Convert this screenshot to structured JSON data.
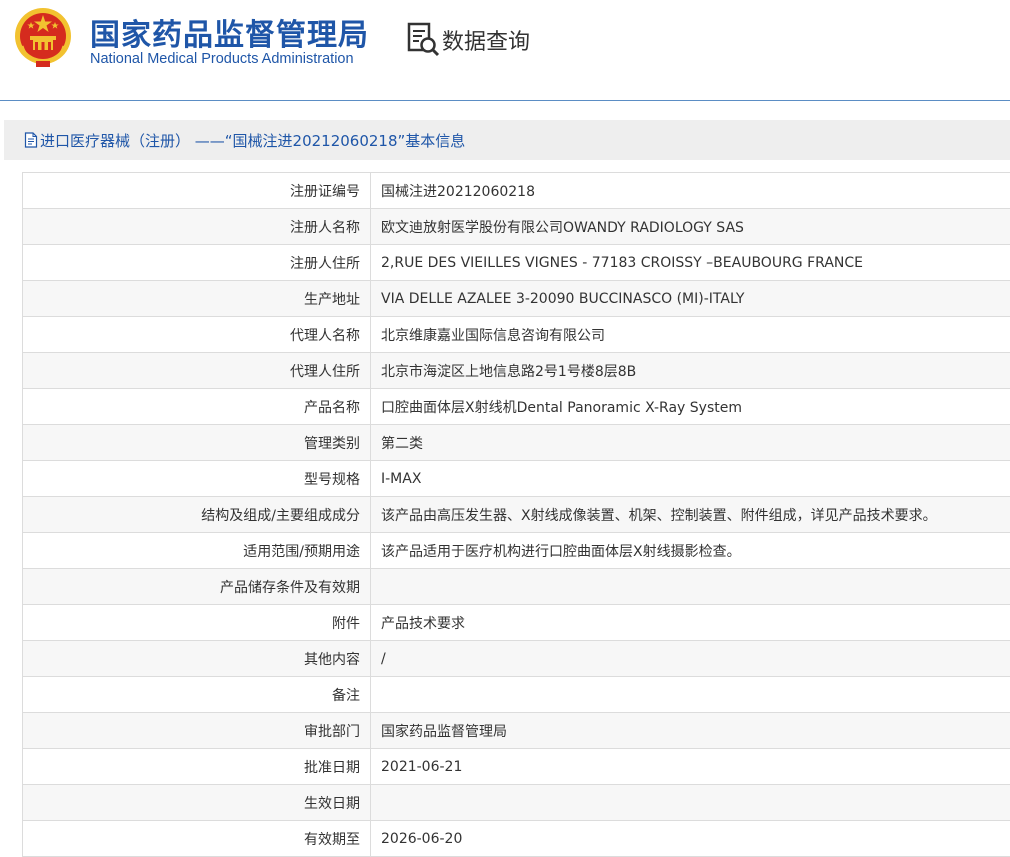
{
  "header": {
    "org_name_cn": "国家药品监督管理局",
    "org_name_en": "National Medical Products Administration",
    "query_label": "数据查询",
    "emblem_icon": "national-emblem-icon",
    "query_icon": "document-search-icon"
  },
  "record": {
    "title": "进口医疗器械（注册） ——“国械注进20212060218”基本信息",
    "title_icon": "document-icon",
    "rows": [
      {
        "label": "注册证编号",
        "value": "国械注进20212060218"
      },
      {
        "label": "注册人名称",
        "value": "欧文迪放射医学股份有限公司OWANDY RADIOLOGY SAS"
      },
      {
        "label": "注册人住所",
        "value": "2,RUE DES VIEILLES VIGNES - 77183 CROISSY –BEAUBOURG FRANCE"
      },
      {
        "label": "生产地址",
        "value": "VIA DELLE AZALEE 3-20090 BUCCINASCO (MI)-ITALY"
      },
      {
        "label": "代理人名称",
        "value": "北京维康嘉业国际信息咨询有限公司"
      },
      {
        "label": "代理人住所",
        "value": "北京市海淀区上地信息路2号1号楼8层8B"
      },
      {
        "label": "产品名称",
        "value": "口腔曲面体层X射线机Dental Panoramic X-Ray System"
      },
      {
        "label": "管理类别",
        "value": "第二类"
      },
      {
        "label": "型号规格",
        "value": "I-MAX"
      },
      {
        "label": "结构及组成/主要组成成分",
        "value": "该产品由高压发生器、X射线成像装置、机架、控制装置、附件组成，详见产品技术要求。"
      },
      {
        "label": "适用范围/预期用途",
        "value": "该产品适用于医疗机构进行口腔曲面体层X射线摄影检查。"
      },
      {
        "label": "产品储存条件及有效期",
        "value": ""
      },
      {
        "label": "附件",
        "value": "产品技术要求"
      },
      {
        "label": "其他内容",
        "value": "/"
      },
      {
        "label": "备注",
        "value": ""
      },
      {
        "label": "审批部门",
        "value": "国家药品监督管理局"
      },
      {
        "label": "批准日期",
        "value": "2021-06-21"
      },
      {
        "label": "生效日期",
        "value": ""
      },
      {
        "label": "有效期至",
        "value": "2026-06-20"
      }
    ]
  },
  "colors": {
    "brand_blue": "#1f56a8",
    "emblem_red": "#d52b1e",
    "emblem_gold": "#f2c230",
    "title_bar_bg": "#eeeeee",
    "row_alt_bg": "#f7f7f7",
    "border": "#dcdcdc"
  }
}
